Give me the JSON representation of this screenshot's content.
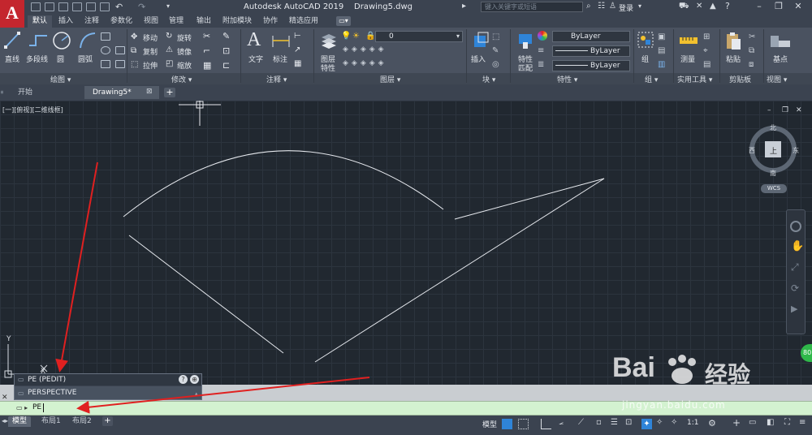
{
  "app": {
    "title": "Autodesk AutoCAD 2019",
    "drawing_name": "Drawing5.dwg",
    "logo_letter": "A",
    "search_placeholder": "键入关键字或短语",
    "login": "登录"
  },
  "ribbon_tabs": [
    "默认",
    "插入",
    "注释",
    "参数化",
    "视图",
    "管理",
    "输出",
    "附加模块",
    "协作",
    "精选应用"
  ],
  "draw_panel": {
    "line": "直线",
    "polyline": "多段线",
    "circle": "圆",
    "arc": "圆弧",
    "label": "绘图"
  },
  "modify_panel": {
    "move": "移动",
    "rotate": "旋转",
    "copy": "复制",
    "mirror": "镜像",
    "stretch": "拉伸",
    "scale": "缩放",
    "label": "修改"
  },
  "annotation_panel": {
    "text": "文字",
    "dimension": "标注",
    "label": "注释"
  },
  "layers_panel": {
    "layer_props_1": "图层",
    "layer_props_2": "特性",
    "layer_value": "0",
    "label": "图层"
  },
  "block_panel": {
    "insert": "插入",
    "label": "块"
  },
  "properties_panel": {
    "match_1": "特性",
    "match_2": "匹配",
    "color": "ByLayer",
    "linetype": "ByLayer",
    "lineweight": "ByLayer",
    "label": "特性"
  },
  "groups_panel": {
    "group": "组",
    "label": "组"
  },
  "utilities_panel": {
    "measure": "测量",
    "label": "实用工具"
  },
  "clipboard_panel": {
    "paste": "粘贴",
    "label": "剪贴板"
  },
  "view_panel": {
    "base": "基点",
    "label": "视图"
  },
  "file_tabs": {
    "start": "开始",
    "drawing": "Drawing5*"
  },
  "viewport_label": "[一][俯视][二维线框]",
  "viewcube": {
    "north": "北",
    "south": "南",
    "east": "东",
    "west": "西",
    "top": "上",
    "wcs": "WCS"
  },
  "autocomplete": {
    "item1": "PE (PEDIT)",
    "item2": "PERSPECTIVE"
  },
  "command": {
    "value": "PE"
  },
  "layout_tabs": [
    "模型",
    "布局1",
    "布局2"
  ],
  "statusbar": {
    "model": "模型",
    "scale": "1:1"
  },
  "side_badge": "80",
  "watermark": {
    "brand": "Bai",
    "brand_cn": "经验",
    "url": "jingyan.baidu.com"
  },
  "colors": {
    "canvas": "#212830",
    "grid": "#2c343e",
    "ribbon": "#4a5260",
    "command_bar": "#d3f2d0",
    "arrow": "#e02020",
    "accent": "#2f84d8"
  }
}
